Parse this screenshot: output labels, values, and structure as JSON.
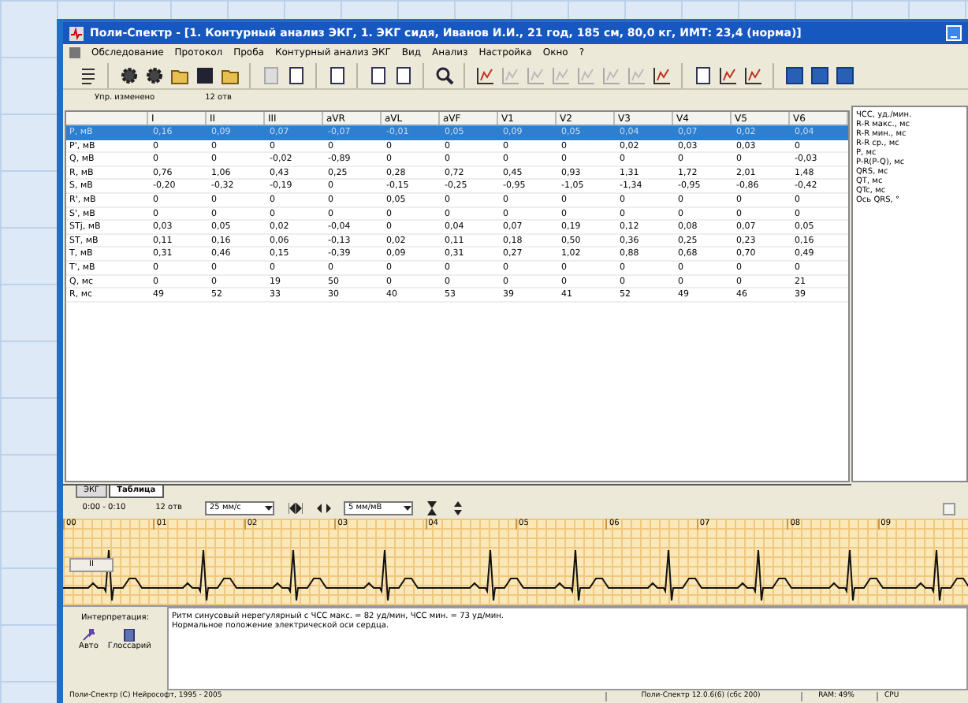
{
  "window": {
    "title": "Поли-Спектр - [1. Контурный анализ ЭКГ, 1. ЭКГ сидя, Иванов И.И., 21 год, 185 см, 80,0 кг, ИМТ: 23,4 (норма)]"
  },
  "menu": [
    "Обследование",
    "Протокол",
    "Проба",
    "Контурный анализ ЭКГ",
    "Вид",
    "Анализ",
    "Настройка",
    "Окно",
    "?"
  ],
  "subbar": [
    "Упр. изменено",
    "12 отв"
  ],
  "table": {
    "columns": [
      "I",
      "II",
      "III",
      "aVR",
      "aVL",
      "aVF",
      "V1",
      "V2",
      "V3",
      "V4",
      "V5",
      "V6"
    ],
    "rows": [
      {
        "label": "P, мВ",
        "selected": true,
        "cells": [
          "0,16",
          "0,09",
          "0,07",
          "-0,07",
          "-0,01",
          "0,05",
          "0,09",
          "0,05",
          "0,04",
          "0,07",
          "0,02",
          "0,04"
        ]
      },
      {
        "label": "P', мВ",
        "selected": false,
        "cells": [
          "0",
          "0",
          "0",
          "0",
          "0",
          "0",
          "0",
          "0",
          "0,02",
          "0,03",
          "0,03",
          "0"
        ]
      },
      {
        "label": "Q, мВ",
        "selected": false,
        "cells": [
          "0",
          "0",
          "-0,02",
          "-0,89",
          "0",
          "0",
          "0",
          "0",
          "0",
          "0",
          "0",
          "-0,03"
        ]
      },
      {
        "label": "R, мВ",
        "selected": false,
        "cells": [
          "0,76",
          "1,06",
          "0,43",
          "0,25",
          "0,28",
          "0,72",
          "0,45",
          "0,93",
          "1,31",
          "1,72",
          "2,01",
          "1,48"
        ]
      },
      {
        "label": "S, мВ",
        "selected": false,
        "cells": [
          "-0,20",
          "-0,32",
          "-0,19",
          "0",
          "-0,15",
          "-0,25",
          "-0,95",
          "-1,05",
          "-1,34",
          "-0,95",
          "-0,86",
          "-0,42"
        ]
      },
      {
        "label": "R', мВ",
        "selected": false,
        "cells": [
          "0",
          "0",
          "0",
          "0",
          "0,05",
          "0",
          "0",
          "0",
          "0",
          "0",
          "0",
          "0"
        ]
      },
      {
        "label": "S', мВ",
        "selected": false,
        "cells": [
          "0",
          "0",
          "0",
          "0",
          "0",
          "0",
          "0",
          "0",
          "0",
          "0",
          "0",
          "0"
        ]
      },
      {
        "label": "STj, мВ",
        "selected": false,
        "cells": [
          "0,03",
          "0,05",
          "0,02",
          "-0,04",
          "0",
          "0,04",
          "0,07",
          "0,19",
          "0,12",
          "0,08",
          "0,07",
          "0,05"
        ]
      },
      {
        "label": "ST, мВ",
        "selected": false,
        "cells": [
          "0,11",
          "0,16",
          "0,06",
          "-0,13",
          "0,02",
          "0,11",
          "0,18",
          "0,50",
          "0,36",
          "0,25",
          "0,23",
          "0,16"
        ]
      },
      {
        "label": "T, мВ",
        "selected": false,
        "cells": [
          "0,31",
          "0,46",
          "0,15",
          "-0,39",
          "0,09",
          "0,31",
          "0,27",
          "1,02",
          "0,88",
          "0,68",
          "0,70",
          "0,49"
        ]
      },
      {
        "label": "T', мВ",
        "selected": false,
        "cells": [
          "0",
          "0",
          "0",
          "0",
          "0",
          "0",
          "0",
          "0",
          "0",
          "0",
          "0",
          "0"
        ]
      },
      {
        "label": "Q, мс",
        "selected": false,
        "cells": [
          "0",
          "0",
          "19",
          "50",
          "0",
          "0",
          "0",
          "0",
          "0",
          "0",
          "0",
          "21"
        ]
      },
      {
        "label": "R, мс",
        "selected": false,
        "cells": [
          "49",
          "52",
          "33",
          "30",
          "40",
          "53",
          "39",
          "41",
          "52",
          "49",
          "46",
          "39"
        ]
      }
    ]
  },
  "parameters": [
    "ЧСС, уд./мин.",
    "R-R макс., мс",
    "R-R мин., мс",
    "R-R ср., мс",
    "P, мс",
    "P-R(P-Q), мс",
    "QRS, мс",
    "QT, мс",
    "QTc, мс",
    "Ось QRS, °"
  ],
  "tabs": [
    {
      "label": "ЭКГ",
      "selected": false
    },
    {
      "label": "Таблица",
      "selected": true
    }
  ],
  "controls": {
    "time_range": "0:00 - 0:10",
    "leads": "12 отв",
    "speed": "25 мм/с",
    "gain": "5 мм/мВ"
  },
  "ecg": {
    "time_marks": [
      "00",
      "01",
      "02",
      "03",
      "04",
      "05",
      "06",
      "07",
      "08",
      "09"
    ],
    "lead": "II"
  },
  "interpretation": {
    "label": "Интерпретация:",
    "buttons": [
      "Авто",
      "Глоссарий"
    ],
    "text": [
      "Ритм синусовый нерегулярный с ЧСС макс. = 82 уд/мин, ЧСС мин. = 73 уд/мин.",
      "Нормальное положение электрической оси сердца."
    ]
  },
  "status_bar": [
    "Поли-Спектр (С) Нейрософт, 1995 - 2005",
    "Поли-Спектр 12.0.6(6) (сбс 200)",
    "RAM: 49%",
    "CPU"
  ]
}
